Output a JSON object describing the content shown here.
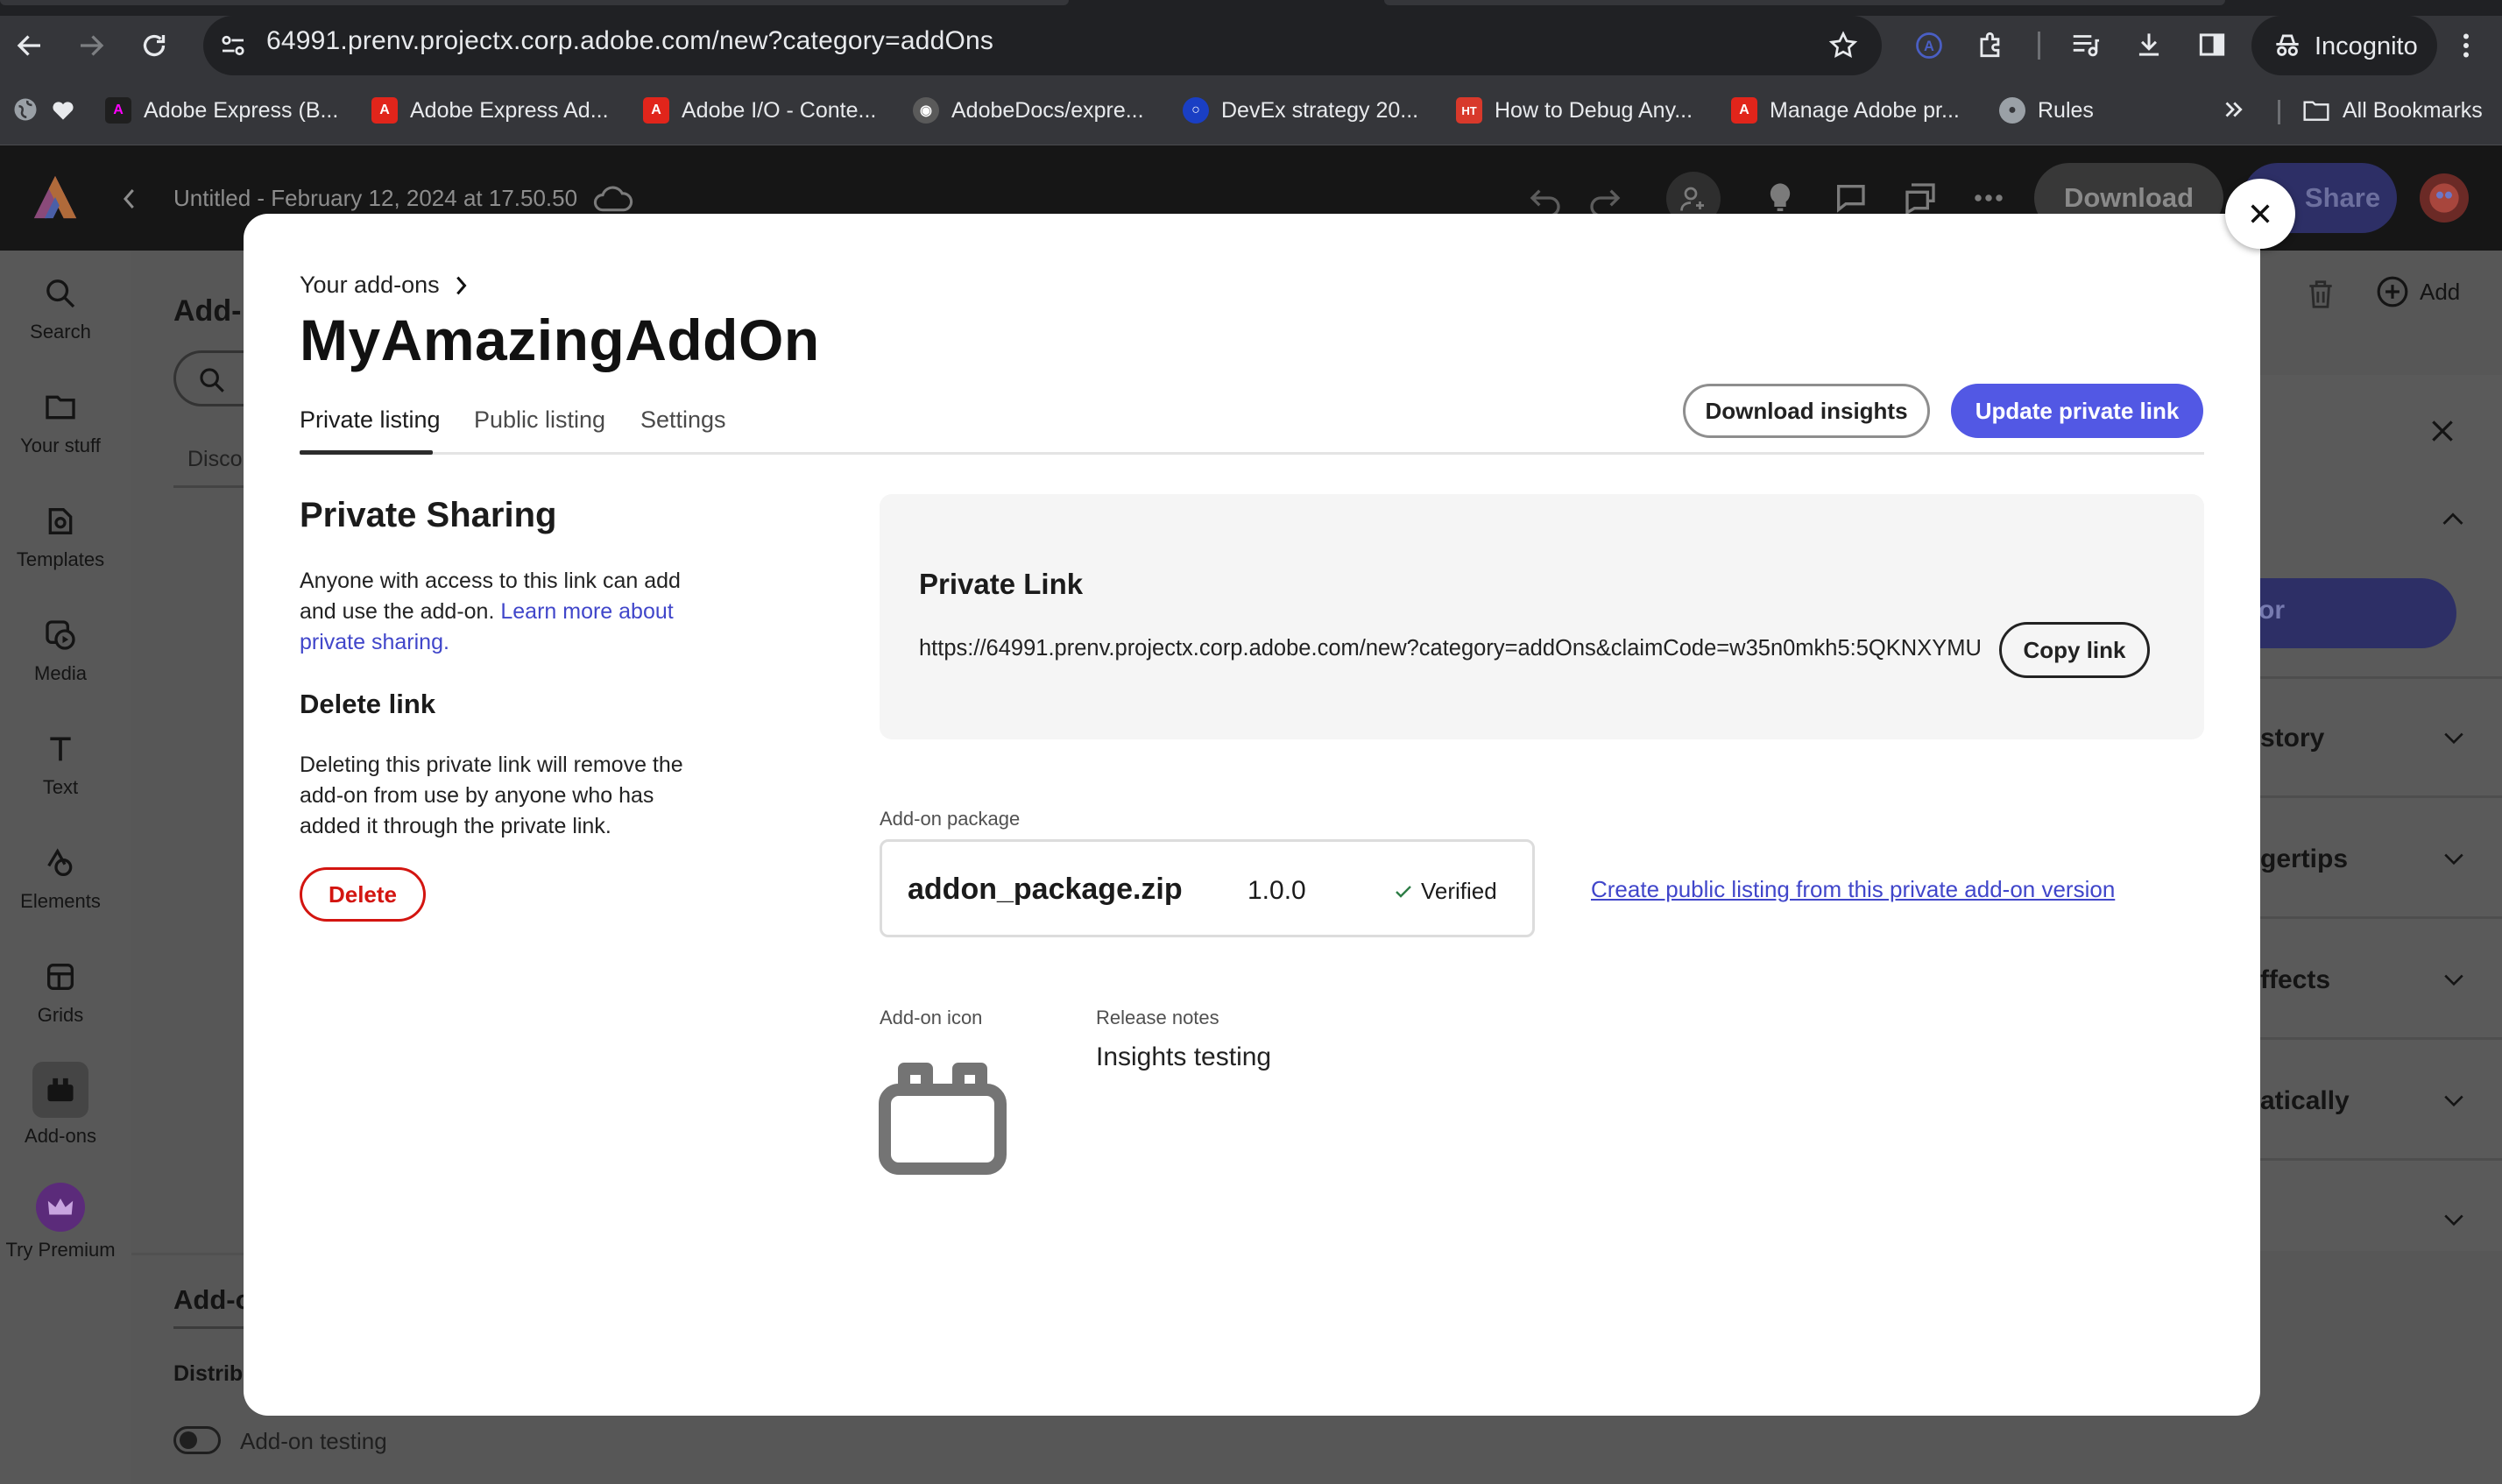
{
  "browser": {
    "url": "64991.prenv.projectx.corp.adobe.com/new?category=addOns",
    "mode_label": "Incognito",
    "bookmarks": [
      {
        "label": "Adobe Express (B...",
        "icon": "adobe-express-icon",
        "color": "#1f1f1f"
      },
      {
        "label": "Adobe Express Ad...",
        "icon": "adobe-icon",
        "color": "#e1251b"
      },
      {
        "label": "Adobe I/O - Conte...",
        "icon": "adobe-icon",
        "color": "#e1251b"
      },
      {
        "label": "AdobeDocs/expre...",
        "icon": "github-icon",
        "color": "#5a5a5a"
      },
      {
        "label": "DevEx strategy 20...",
        "icon": "circle-icon",
        "color": "#1a3fc4"
      },
      {
        "label": "How to Debug Any...",
        "icon": "ht-icon",
        "color": "#d8392b"
      },
      {
        "label": "Manage Adobe pr...",
        "icon": "adobe-icon",
        "color": "#e1251b"
      },
      {
        "label": "Rules",
        "icon": "globe-icon",
        "color": "#9aa0a6"
      }
    ],
    "all_bookmarks_label": "All Bookmarks"
  },
  "app": {
    "document_title": "Untitled - February 12, 2024 at 17.50.50",
    "download_label": "Download",
    "share_label": "Share",
    "add_label": "Add",
    "brand_color": "#5258e4"
  },
  "rail": [
    {
      "label": "Search",
      "icon": "search-icon"
    },
    {
      "label": "Your stuff",
      "icon": "folder-icon"
    },
    {
      "label": "Templates",
      "icon": "templates-icon"
    },
    {
      "label": "Media",
      "icon": "media-icon"
    },
    {
      "label": "Text",
      "icon": "text-icon"
    },
    {
      "label": "Elements",
      "icon": "elements-icon"
    },
    {
      "label": "Grids",
      "icon": "grids-icon"
    },
    {
      "label": "Add-ons",
      "icon": "addons-icon"
    },
    {
      "label": "Try Premium",
      "icon": "crown-icon"
    }
  ],
  "background_panel": {
    "heading": "Add-",
    "tab_partial": "Disco",
    "section_heading": "Add-o",
    "distribute_partial": "Distrib",
    "toggle_label": "Add-on testing"
  },
  "right_panel": {
    "button_partial": "tor",
    "items": [
      "story",
      "gertips",
      "ffects",
      "atically"
    ]
  },
  "modal": {
    "breadcrumb": "Your add-ons",
    "title": "MyAmazingAddOn",
    "tabs": [
      {
        "label": "Private listing",
        "active": true
      },
      {
        "label": "Public listing",
        "active": false
      },
      {
        "label": "Settings",
        "active": false
      }
    ],
    "download_insights_label": "Download insights",
    "update_link_label": "Update private link",
    "private_sharing": {
      "heading": "Private Sharing",
      "text": "Anyone with access to this link can add and use the add-on.",
      "learn_more": "Learn more about private sharing."
    },
    "delete_link": {
      "heading": "Delete link",
      "text": "Deleting this private link will remove the add-on from use by anyone who has added it through the private link.",
      "button_label": "Delete"
    },
    "private_link": {
      "heading": "Private Link",
      "url": "https://64991.prenv.projectx.corp.adobe.com/new?category=addOns&claimCode=w35n0mkh5:5QKNXYMU",
      "copy_label": "Copy link"
    },
    "package": {
      "label": "Add-on package",
      "filename": "addon_package.zip",
      "version": "1.0.0",
      "status": "Verified",
      "create_public_link": "Create public listing from this private add-on version"
    },
    "icon_label": "Add-on icon",
    "release_notes": {
      "label": "Release notes",
      "value": "Insights testing"
    }
  }
}
